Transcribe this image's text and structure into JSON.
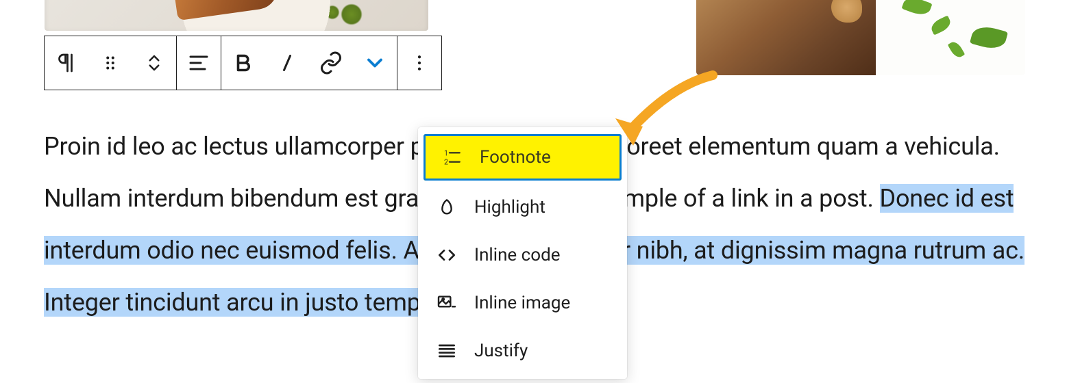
{
  "toolbar": {
    "paragraph_label": "Paragraph block",
    "drag_label": "Drag",
    "move_label": "Move up/down",
    "align_label": "Align",
    "bold_label": "Bold",
    "italic_label": "Italic",
    "link_label": "Link",
    "more_rich_label": "More rich text controls",
    "options_label": "Options"
  },
  "dropdown": {
    "items": [
      {
        "label": "Footnote",
        "highlighted": true
      },
      {
        "label": "Highlight",
        "highlighted": false
      },
      {
        "label": "Inline code",
        "highlighted": false
      },
      {
        "label": "Inline image",
        "highlighted": false
      },
      {
        "label": "Justify",
        "highlighted": false
      }
    ]
  },
  "paragraph": {
    "part1": "Proin id leo ac lectus ullamcorper posuere ac dui. In laoreet elementum quam a vehicula. Nullam interdum bibendum est gravida. This is an example of a link in a post. ",
    "selected": "Donec id est interdum odio nec euismod felis. Aliquam varius tortor nibh, at dignissim magna rutrum ac. Integer tincidunt arcu in justo tempor euismod."
  },
  "annotation": {
    "color": "#f5a623"
  }
}
